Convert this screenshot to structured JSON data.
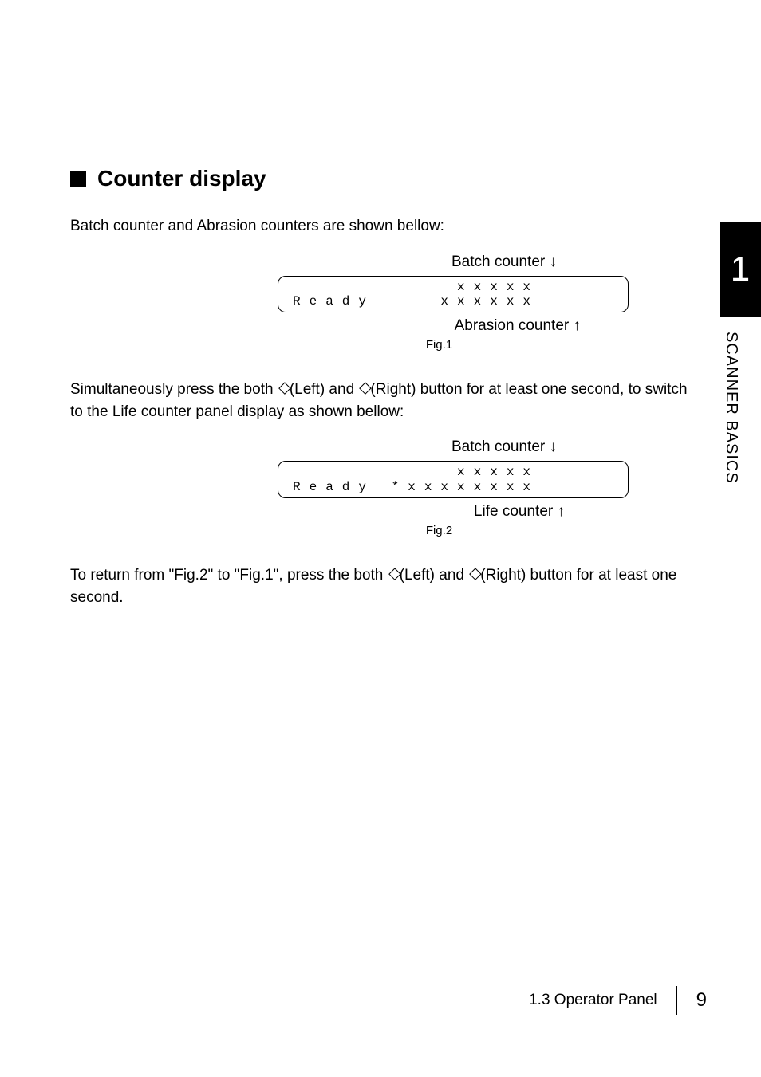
{
  "tab": {
    "number": "1",
    "section": "SCANNER BASICS"
  },
  "h2": "Counter display",
  "p1": "Batch counter and Abrasion counters are shown bellow:",
  "p2_a": "Simultaneously press the both ",
  "p2_b": "(Left) and ",
  "p2_c": "(Right) button for at least one second, to switch to the Life counter panel display as shown bellow:",
  "p3_a": "To return from \"Fig.2\" to \"Fig.1\", press the both ",
  "p3_b": "(Left) and ",
  "p3_c": "(Right) button for at least one second.",
  "chart_data": [
    {
      "type": "table",
      "title": "Fig.1",
      "top_label": "Batch counter ↓",
      "bottom_label": "Abrasion counter ↑",
      "rows": [
        "          xxxxx",
        "Ready    xxxxxx"
      ]
    },
    {
      "type": "table",
      "title": "Fig.2",
      "top_label": "Batch counter ↓",
      "bottom_label": "Life counter ↑",
      "rows": [
        "          xxxxx",
        "Ready *xxxxxxxx"
      ]
    }
  ],
  "footer": {
    "section": "1.3 Operator Panel",
    "page": "9"
  }
}
